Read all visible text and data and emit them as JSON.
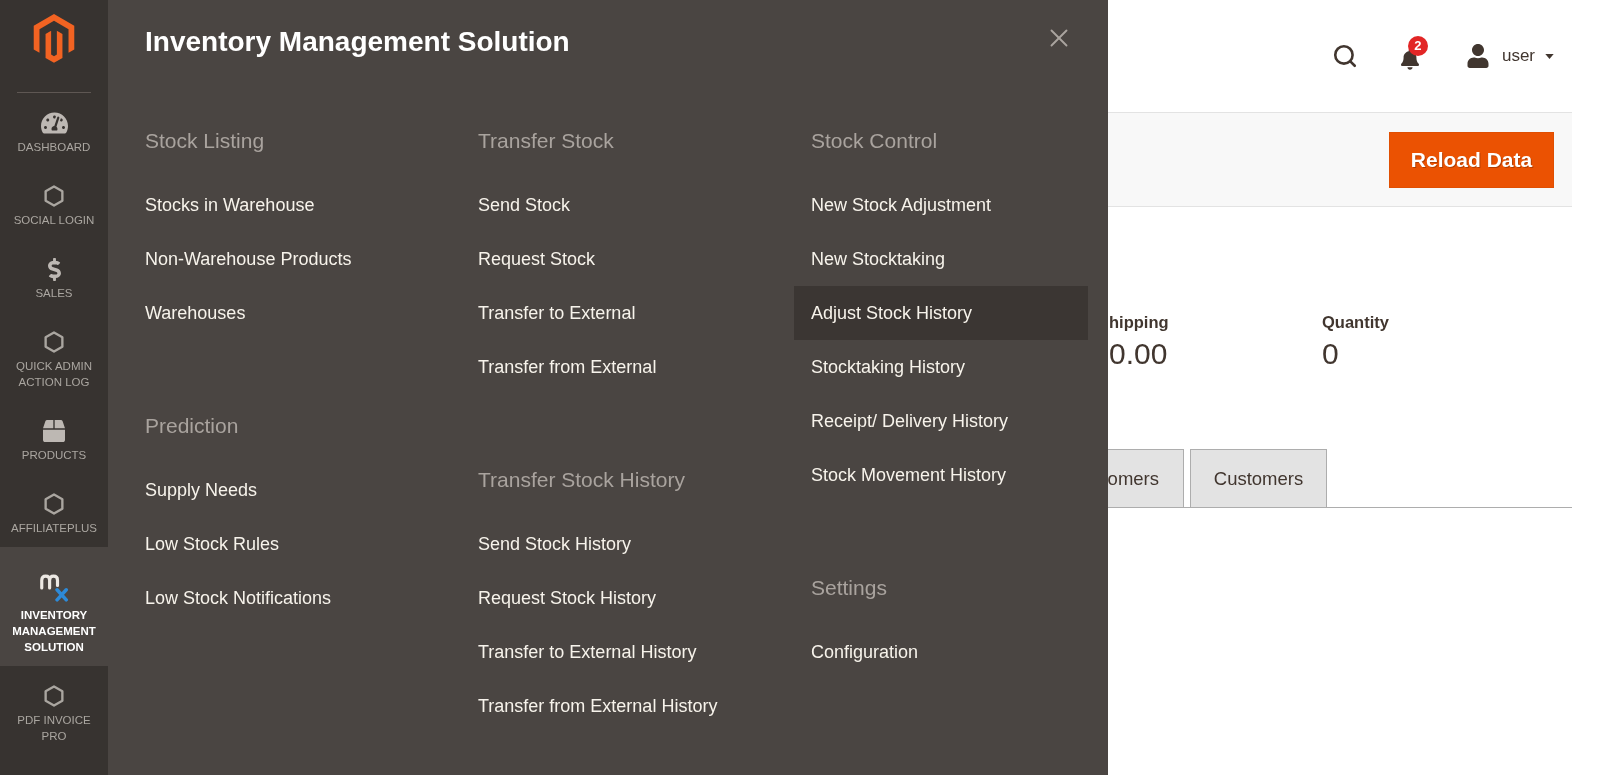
{
  "sidebar": {
    "items": [
      {
        "label": "DASHBOARD",
        "kind": "dashboard",
        "selected": false
      },
      {
        "label": "SOCIAL LOGIN",
        "kind": "module",
        "selected": false
      },
      {
        "label": "SALES",
        "kind": "sales",
        "selected": false
      },
      {
        "label": "QUICK ADMIN ACTION LOG",
        "kind": "module",
        "selected": false
      },
      {
        "label": "PRODUCTS",
        "kind": "catalog",
        "selected": false
      },
      {
        "label": "AFFILIATEPLUS",
        "kind": "module",
        "selected": false
      },
      {
        "label": "INVENTORY MANAGEMENT SOLUTION",
        "kind": "inventory",
        "selected": true
      },
      {
        "label": "PDF INVOICE PRO",
        "kind": "module",
        "selected": false
      }
    ]
  },
  "menu": {
    "title": "Inventory Management Solution",
    "columns": [
      {
        "groups": [
          {
            "heading": "Stock Listing",
            "items": [
              {
                "label": "Stocks in Warehouse",
                "highlighted": false
              },
              {
                "label": "Non-Warehouse Products",
                "highlighted": false
              },
              {
                "label": "Warehouses",
                "highlighted": false
              }
            ]
          },
          {
            "heading": "Prediction",
            "items": [
              {
                "label": "Supply Needs",
                "highlighted": false
              },
              {
                "label": "Low Stock Rules",
                "highlighted": false
              },
              {
                "label": "Low Stock Notifications",
                "highlighted": false
              }
            ]
          }
        ]
      },
      {
        "groups": [
          {
            "heading": "Transfer Stock",
            "items": [
              {
                "label": "Send Stock",
                "highlighted": false
              },
              {
                "label": "Request Stock",
                "highlighted": false
              },
              {
                "label": "Transfer to External",
                "highlighted": false
              },
              {
                "label": "Transfer from External",
                "highlighted": false
              }
            ]
          },
          {
            "heading": "Transfer Stock History",
            "items": [
              {
                "label": "Send Stock History",
                "highlighted": false
              },
              {
                "label": "Request Stock History",
                "highlighted": false
              },
              {
                "label": "Transfer to External History",
                "highlighted": false
              },
              {
                "label": "Transfer from External History",
                "highlighted": false
              }
            ]
          }
        ]
      },
      {
        "groups": [
          {
            "heading": "Stock Control",
            "items": [
              {
                "label": "New Stock Adjustment",
                "highlighted": false
              },
              {
                "label": "New Stocktaking",
                "highlighted": false
              },
              {
                "label": "Adjust Stock History",
                "highlighted": true
              },
              {
                "label": "Stocktaking History",
                "highlighted": false
              },
              {
                "label": "Receipt/ Delivery History",
                "highlighted": false
              },
              {
                "label": "Stock Movement History",
                "highlighted": false
              }
            ]
          },
          {
            "heading": "Settings",
            "items": [
              {
                "label": "Configuration",
                "highlighted": false
              }
            ]
          }
        ]
      }
    ]
  },
  "header": {
    "notification_count": "2",
    "user": "user"
  },
  "actions": {
    "reload_button": "Reload Data"
  },
  "stats": [
    {
      "label": "hipping",
      "value": "0.00"
    },
    {
      "label": "Quantity",
      "value": "0"
    }
  ],
  "tabs": [
    {
      "label": "omers"
    },
    {
      "label": "Customers"
    }
  ]
}
